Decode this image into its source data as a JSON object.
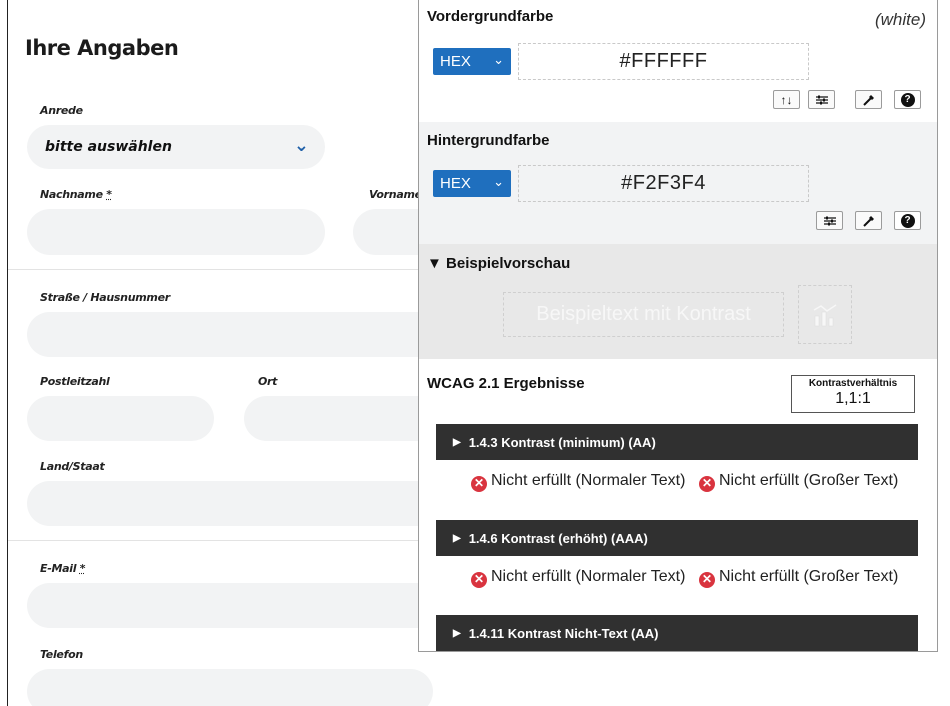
{
  "form": {
    "title": "Ihre Angaben",
    "anrede_label": "Anrede",
    "anrede_value": "bitte auswählen",
    "nachname_label": "Nachname",
    "vorname_label": "Vorname",
    "required_mark": "*",
    "strasse_label": "Straße / Hausnummer",
    "plz_label": "Postleitzahl",
    "ort_label": "Ort",
    "land_label": "Land/Staat",
    "email_label": "E-Mail",
    "telefon_label": "Telefon"
  },
  "panel": {
    "foreground": {
      "title": "Vordergrundfarbe",
      "color_name": "(white)",
      "format": "HEX",
      "value": "#FFFFFF"
    },
    "background": {
      "title": "Hintergrundfarbe",
      "format": "HEX",
      "value": "#F2F3F4"
    },
    "preview": {
      "title": "▼ Beispielvorschau",
      "sample_text": "Beispieltext mit Kontrast"
    },
    "results": {
      "title": "WCAG 2.1 Ergebnisse",
      "ratio_label": "Kontrastverhältnis",
      "ratio_value": "1,1:1",
      "criteria": [
        {
          "label": "1.4.3 Kontrast (minimum) (AA)",
          "normal_text": "Nicht erfüllt (Normaler Text)",
          "large_text": "Nicht erfüllt (Großer Text)"
        },
        {
          "label": "1.4.6 Kontrast (erhöht) (AAA)",
          "normal_text": "Nicht erfüllt (Normaler Text)",
          "large_text": "Nicht erfüllt (Großer Text)"
        },
        {
          "label": "1.4.11 Kontrast Nicht-Text (AA)"
        }
      ]
    },
    "icons": {
      "swap": "swap-icon",
      "sliders": "sliders-icon",
      "eyedropper": "eyedropper-icon",
      "help": "help-icon",
      "fail": "fail-x-icon",
      "chart": "chart-icon"
    },
    "colors": {
      "hex_select": "#1f6fbe",
      "criterion_bar": "#303030",
      "fail": "#d9343f",
      "background_section": "#f2f3f4"
    }
  }
}
